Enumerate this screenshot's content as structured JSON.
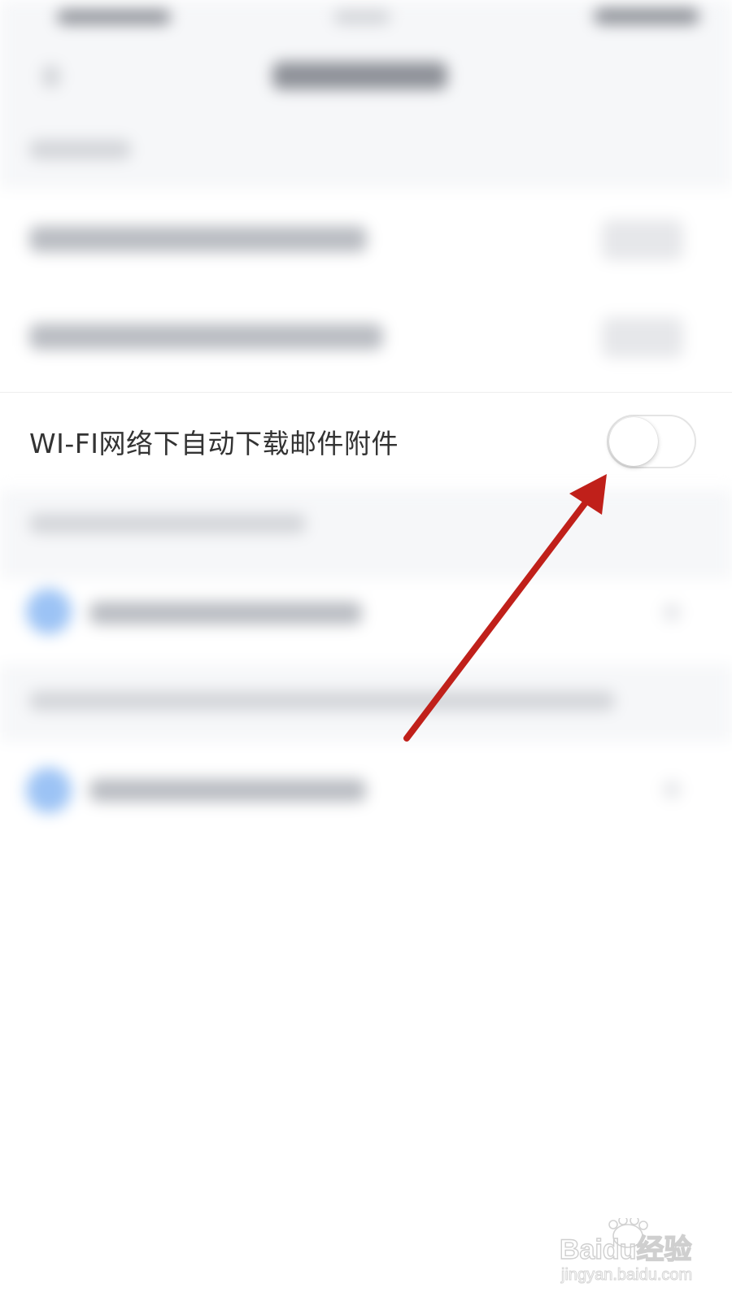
{
  "setting": {
    "label": "WI-FI网络下自动下载邮件附件",
    "enabled": false
  },
  "watermark": {
    "brand": "Baidu经验",
    "url": "jingyan.baidu.com"
  },
  "colors": {
    "arrow": "#c0201a",
    "toggle_border": "#e4e4e4",
    "label_text": "#333333",
    "blurred_icon": "#9cc3f5"
  },
  "icons": {
    "annotation": "red-arrow-icon",
    "watermark": "baidu-paw-logo"
  }
}
